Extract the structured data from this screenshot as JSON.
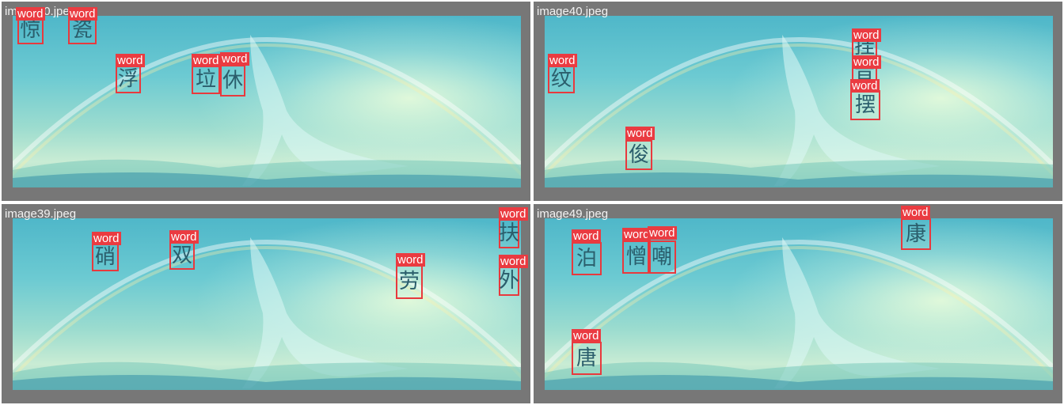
{
  "colors": {
    "box": "#e8393d",
    "tag_background": "#ea3b41",
    "panel_background": "#777777",
    "glyph": "#2b5e6c"
  },
  "panels": [
    {
      "filename": "image50.jpeg",
      "detections": [
        {
          "label": "word",
          "char": "惊"
        },
        {
          "label": "word",
          "char": "瓷"
        },
        {
          "label": "word",
          "char": "浮"
        },
        {
          "label": "word",
          "char": "垃"
        },
        {
          "label": "word",
          "char": "休"
        }
      ]
    },
    {
      "filename": "image40.jpeg",
      "detections": [
        {
          "label": "word",
          "char": "纹"
        },
        {
          "label": "word",
          "char": "挂"
        },
        {
          "label": "word",
          "char": "昔"
        },
        {
          "label": "word",
          "char": "摆"
        },
        {
          "label": "word",
          "char": "俊"
        }
      ]
    },
    {
      "filename": "image39.jpeg",
      "detections": [
        {
          "label": "word",
          "char": "硝"
        },
        {
          "label": "word",
          "char": "双"
        },
        {
          "label": "word",
          "char": "劳"
        },
        {
          "label": "word",
          "char": "扶"
        },
        {
          "label": "word",
          "char": "外"
        }
      ]
    },
    {
      "filename": "image49.jpeg",
      "detections": [
        {
          "label": "word",
          "char": "泊"
        },
        {
          "label": "word",
          "char": "憎"
        },
        {
          "label": "word",
          "char": "嘲"
        },
        {
          "label": "word",
          "char": "康"
        },
        {
          "label": "word",
          "char": "唐"
        }
      ]
    }
  ]
}
